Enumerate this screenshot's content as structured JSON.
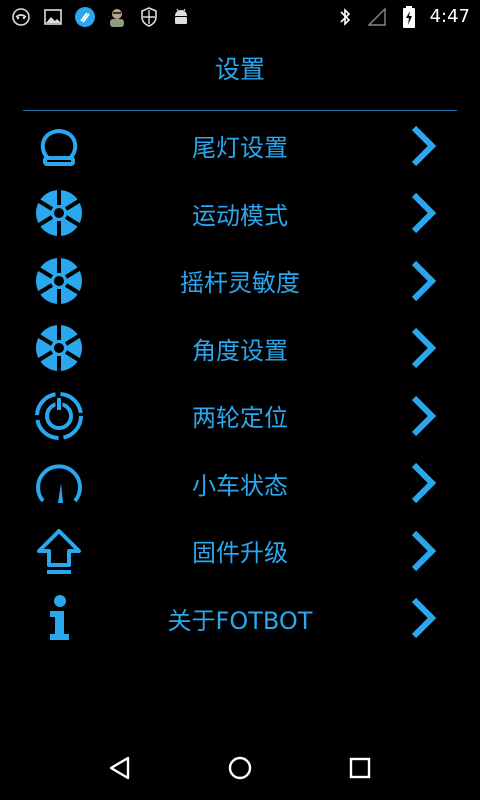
{
  "status_bar": {
    "time": "4:47",
    "left_icons": [
      "mask-icon",
      "image-icon",
      "cleaner-icon",
      "avatar-icon",
      "shield-icon",
      "android-icon"
    ],
    "right_icons": [
      "bluetooth-icon",
      "signal-icon",
      "battery-charging-icon"
    ]
  },
  "header": {
    "title": "设置"
  },
  "menu": {
    "items": [
      {
        "label": "尾灯设置",
        "icon": "taillight-icon"
      },
      {
        "label": "运动模式",
        "icon": "wheel-icon"
      },
      {
        "label": "摇杆灵敏度",
        "icon": "wheel-icon"
      },
      {
        "label": "角度设置",
        "icon": "wheel-icon"
      },
      {
        "label": "两轮定位",
        "icon": "power-ring-icon"
      },
      {
        "label": "小车状态",
        "icon": "gauge-icon"
      },
      {
        "label": "固件升级",
        "icon": "upload-arrow-icon"
      },
      {
        "label": "关于FOTBOT",
        "icon": "info-icon"
      }
    ]
  },
  "nav_bar": {
    "buttons": [
      "back-icon",
      "home-icon",
      "recents-icon"
    ]
  },
  "colors": {
    "accent": "#2aa7ee",
    "background": "#000000",
    "divider": "#1f77a8"
  }
}
